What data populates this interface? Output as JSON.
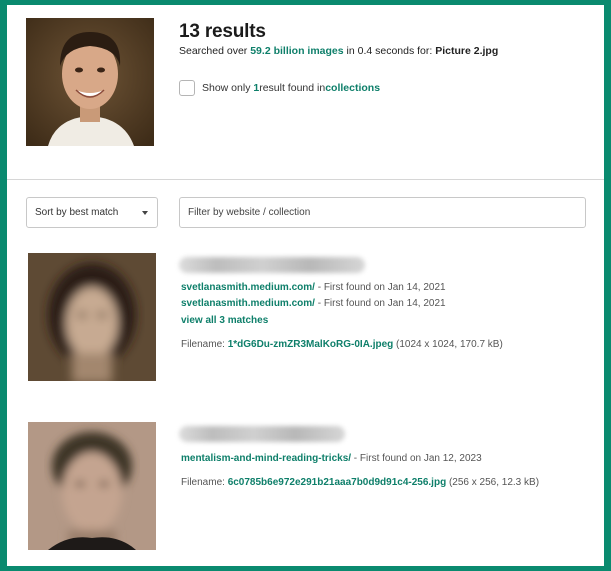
{
  "header": {
    "count": "13 results",
    "searched_prefix": "Searched over ",
    "index_size": "59.2 billion images",
    "searched_mid": " in 0.4 seconds for: ",
    "query_filename": "Picture 2.jpg"
  },
  "collections": {
    "prefix": "Show only ",
    "count": "1",
    "mid": " result found in ",
    "link": "collections"
  },
  "controls": {
    "sort_label": "Sort by best match",
    "filter_placeholder": "Filter by website / collection"
  },
  "results": [
    {
      "matches": [
        {
          "site": "svetlanasmith.medium.com/",
          "found": " - First found on Jan 14, 2021"
        },
        {
          "site": "svetlanasmith.medium.com/",
          "found": " - First found on Jan 14, 2021"
        }
      ],
      "view_all": "view all 3 matches",
      "filename_label": "Filename: ",
      "filename": "1*dG6Du-zmZR3MalKoRG-0IA.jpeg",
      "meta": " (1024 x 1024, 170.7 kB)"
    },
    {
      "matches": [
        {
          "site": "mentalism-and-mind-reading-tricks/",
          "found": " - First found on Jan 12, 2023"
        }
      ],
      "filename_label": "Filename: ",
      "filename": "6c0785b6e972e291b21aaa7b0d9d91c4-256.jpg",
      "meta": " (256 x 256, 12.3 kB)"
    }
  ],
  "colors": {
    "frame": "#0a8a6f",
    "accent": "#0e7f6a"
  }
}
